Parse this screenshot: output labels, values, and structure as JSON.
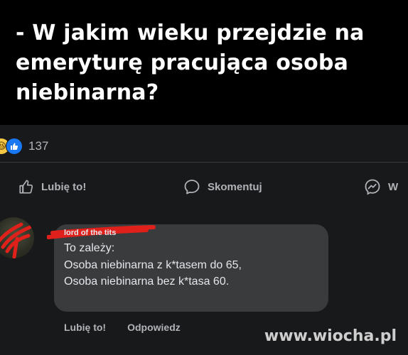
{
  "meme": {
    "title": "- W jakim wieku przejdzie na emeryturę pracująca osoba niebinarna?"
  },
  "post": {
    "reactions": {
      "icons": [
        "haha-reaction-icon",
        "like-reaction-icon"
      ],
      "count": "137"
    },
    "actions": {
      "like_label": "Lubię to!",
      "comment_label": "Skomentuj",
      "share_label": "W"
    }
  },
  "comment": {
    "author": "lord of the tits",
    "lines": [
      "To zależy:",
      "Osoba niebinarna z k*tasem do 65,",
      "Osoba niebinarna  bez k*tasa 60."
    ],
    "actions": {
      "like_label": "Lubię to!",
      "reply_label": "Odpowiedz"
    }
  },
  "watermark": "www.wiocha.pl",
  "colors": {
    "background": "#18191a",
    "bubble": "#3a3b3c",
    "text_primary": "#e4e6eb",
    "text_secondary": "#b0b3b8",
    "like_blue": "#1877f2",
    "redaction_red": "#e0201a"
  }
}
